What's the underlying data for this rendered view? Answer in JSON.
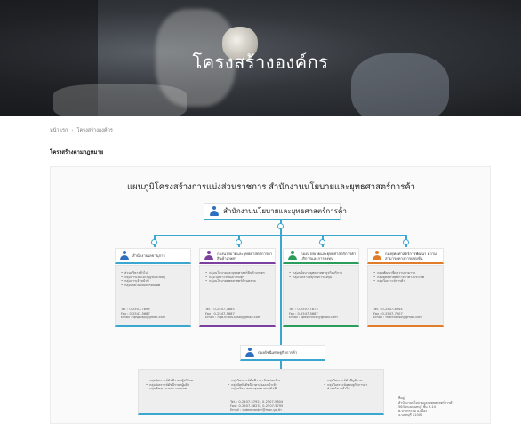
{
  "hero": {
    "title": "โครงสร้างองค์กร"
  },
  "breadcrumb": {
    "home": "หน้าแรก",
    "separator": "›",
    "current": "โครงสร้างองค์กร"
  },
  "section": {
    "title": "โครงสร้างตามกฎหมาย"
  },
  "chart": {
    "title": "แผนภูมิโครงสร้างการแบ่งส่วนราชการ สำนักงานนโยบายและยุทธศาสตร์การค้า",
    "root": {
      "label": "สำนักงานนโยบายและยุทธศาสตร์การค้า"
    },
    "units": [
      {
        "name": "สำนักงานเลขานุการ",
        "color": "#2f6fbf",
        "items": [
          "ส่วนบริหารทั่วไป",
          "กลุ่มการเงินและบัญชีและพัสดุ",
          "กลุ่มการเจ้าหน้าที่",
          "กลุ่มเทคโนโลยีสารสนเทศ"
        ],
        "contact": [
          "Tel. : 0-2507-7895",
          "Fax : 0-2547-5687",
          "Email : tpsppsp@gmail.com"
        ]
      },
      {
        "name": "กองนโยบายและยุทธศาสตร์การค้า สินค้าเกษตร",
        "color": "#7b3fa0",
        "items": [
          "กลุ่มนโยบายและยุทธศาสตร์สินค้าเกษตร",
          "กลุ่มวิเคราะห์สินค้าเกษตร",
          "กลุ่มนโยบายยุทธศาสตร์ด้านตลาด"
        ],
        "contact": [
          "Tel. : 0-2507-7885",
          "Fax : 0-2547-5687",
          "Email : ngo.indus.tpso@gmail.com"
        ]
      },
      {
        "name": "กองนโยบายและยุทธศาสตร์การค้า บริการและการลงทุน",
        "color": "#2a9d5a",
        "items": [
          "กลุ่มนโยบายยุทธศาสตร์ธุรกิจบริการ",
          "กลุ่มวิเคราะห์ธุรกิจการลงทุน"
        ],
        "contact": [
          "Tel. : 0-2507-7873",
          "Fax : 0-2547-5687",
          "Email : tposervice@gmail.com"
        ]
      },
      {
        "name": "กองยุทธศาสตร์การพัฒนา ความสามารถทางการแข่งขัน",
        "color": "#e07c2a",
        "items": [
          "กลุ่มพัฒนาขีดความสามารถ",
          "กลุ่มยุทธศาสตร์การค้าต่างประเทศ",
          "กลุ่มวิเคราะห์การค้า"
        ],
        "contact": [
          "Tel. : 0-2507-8944",
          "Fax : 0-2547-7907",
          "Email : macrotpso@gmail.com"
        ]
      }
    ],
    "index_unit": {
      "name": "กองดัชนีเศรษฐกิจการค้า",
      "color": "#2f6fbf",
      "col1": [
        "กลุ่มวิเคราะห์ดัชนีราคาผู้บริโภค",
        "กลุ่มวิเคราะห์ดัชนีราคาผู้ผลิต",
        "กลุ่มพัฒนาระบบสารสนเทศ"
      ],
      "col2": [
        "กลุ่มวิเคราะห์ดัชนีราคาวัสดุก่อสร้าง",
        "กลุ่มจัดทำดัชนีราคาส่งออกนำเข้า",
        "กลุ่มนโยบายและยุทธศาสตร์ดัชนี"
      ],
      "col3": [
        "กลุ่มวิเคราะห์ดัชนีภูมิภาค",
        "กลุ่มวิเคราะห์เศรษฐกิจการค้า",
        "ฝ่ายบริหารทั่วไป"
      ],
      "contact": [
        "Tel. : 0-2507-5792 , 0-2507-5804",
        "Fax : 0-2507-5825 , 0-2507-5795",
        "Email : indexmaster@moc.go.th"
      ]
    },
    "footnote": [
      "ที่อยู่",
      "สำนักงานนโยบายและยุทธศาสตร์การค้า",
      "563 ถนนนนทบุรี ชั้น 9-14",
      "ต.บางกระสอ อ.เมือง",
      "จ.นนทบุรี 11000"
    ]
  }
}
